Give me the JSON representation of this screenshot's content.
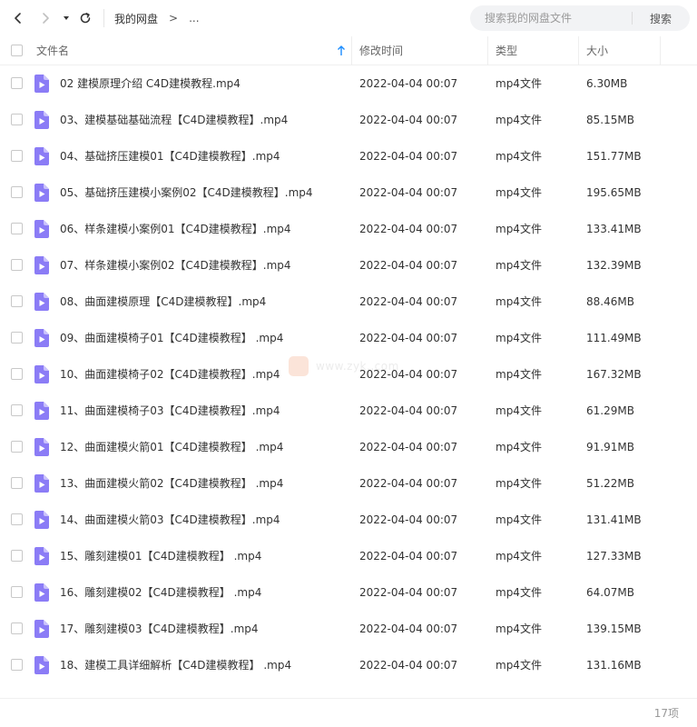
{
  "toolbar": {
    "breadcrumb_root": "我的网盘",
    "breadcrumb_sep": ">",
    "breadcrumb_more": "...",
    "search_placeholder": "搜索我的网盘文件",
    "search_button": "搜索"
  },
  "columns": {
    "name": "文件名",
    "mtime": "修改时间",
    "type": "类型",
    "size": "大小"
  },
  "sort": {
    "column": "name",
    "direction": "ascending",
    "icon": "arrow-up-icon"
  },
  "files": [
    {
      "name": "02 建模原理介绍 C4D建模教程.mp4",
      "mtime": "2022-04-04 00:07",
      "type": "mp4文件",
      "size": "6.30MB"
    },
    {
      "name": "03、建模基础基础流程【C4D建模教程】.mp4",
      "mtime": "2022-04-04 00:07",
      "type": "mp4文件",
      "size": "85.15MB"
    },
    {
      "name": "04、基础挤压建模01【C4D建模教程】.mp4",
      "mtime": "2022-04-04 00:07",
      "type": "mp4文件",
      "size": "151.77MB"
    },
    {
      "name": "05、基础挤压建模小案例02【C4D建模教程】.mp4",
      "mtime": "2022-04-04 00:07",
      "type": "mp4文件",
      "size": "195.65MB"
    },
    {
      "name": "06、样条建模小案例01【C4D建模教程】.mp4",
      "mtime": "2022-04-04 00:07",
      "type": "mp4文件",
      "size": "133.41MB"
    },
    {
      "name": "07、样条建模小案例02【C4D建模教程】.mp4",
      "mtime": "2022-04-04 00:07",
      "type": "mp4文件",
      "size": "132.39MB"
    },
    {
      "name": "08、曲面建模原理【C4D建模教程】.mp4",
      "mtime": "2022-04-04 00:07",
      "type": "mp4文件",
      "size": "88.46MB"
    },
    {
      "name": "09、曲面建模椅子01【C4D建模教程】 .mp4",
      "mtime": "2022-04-04 00:07",
      "type": "mp4文件",
      "size": "111.49MB"
    },
    {
      "name": "10、曲面建模椅子02【C4D建模教程】.mp4",
      "mtime": "2022-04-04 00:07",
      "type": "mp4文件",
      "size": "167.32MB"
    },
    {
      "name": "11、曲面建模椅子03【C4D建模教程】.mp4",
      "mtime": "2022-04-04 00:07",
      "type": "mp4文件",
      "size": "61.29MB"
    },
    {
      "name": "12、曲面建模火箭01【C4D建模教程】 .mp4",
      "mtime": "2022-04-04 00:07",
      "type": "mp4文件",
      "size": "91.91MB"
    },
    {
      "name": "13、曲面建模火箭02【C4D建模教程】 .mp4",
      "mtime": "2022-04-04 00:07",
      "type": "mp4文件",
      "size": "51.22MB"
    },
    {
      "name": "14、曲面建模火箭03【C4D建模教程】.mp4",
      "mtime": "2022-04-04 00:07",
      "type": "mp4文件",
      "size": "131.41MB"
    },
    {
      "name": "15、雕刻建模01【C4D建模教程】 .mp4",
      "mtime": "2022-04-04 00:07",
      "type": "mp4文件",
      "size": "127.33MB"
    },
    {
      "name": "16、雕刻建模02【C4D建模教程】 .mp4",
      "mtime": "2022-04-04 00:07",
      "type": "mp4文件",
      "size": "64.07MB"
    },
    {
      "name": "17、雕刻建模03【C4D建模教程】.mp4",
      "mtime": "2022-04-04 00:07",
      "type": "mp4文件",
      "size": "139.15MB"
    },
    {
      "name": "18、建模工具详细解析【C4D建模教程】 .mp4",
      "mtime": "2022-04-04 00:07",
      "type": "mp4文件",
      "size": "131.16MB"
    }
  ],
  "footer": {
    "count_label": "17项"
  },
  "watermark": {
    "text": "www.zyk..com"
  },
  "icons": {
    "back": "chevron-left-icon",
    "forward": "chevron-right-icon",
    "dropdown": "caret-down-icon",
    "refresh": "refresh-icon",
    "file": "video-file-icon"
  },
  "colors": {
    "file_icon": "#8b7cf6",
    "sort_arrow": "#1a8cff",
    "search_bg": "#f2f3f5",
    "forward_disabled": "#c0c0c0"
  }
}
